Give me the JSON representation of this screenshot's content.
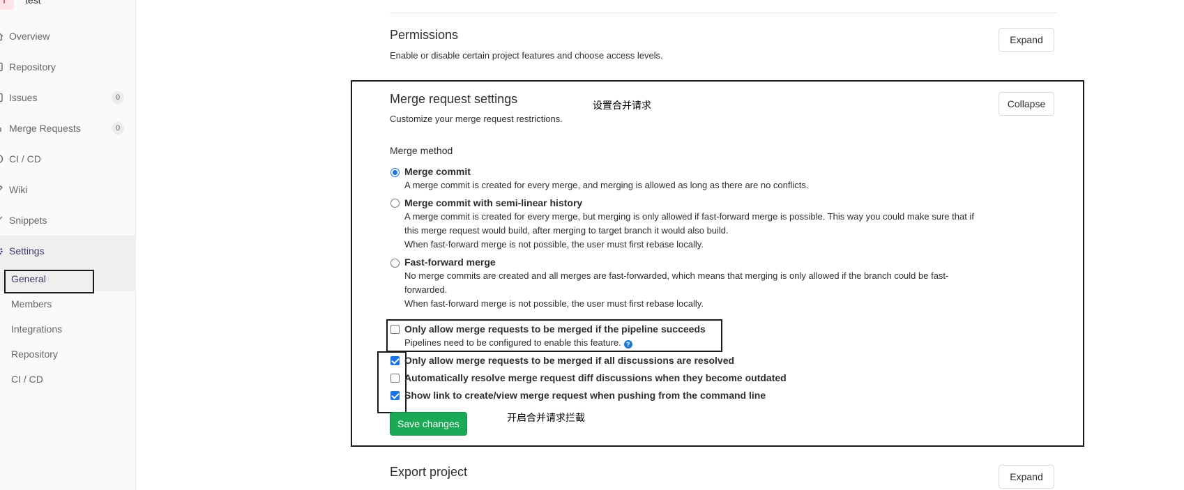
{
  "project": {
    "avatar_letter": "T",
    "name": "test"
  },
  "sidebar": {
    "items": [
      {
        "label": "Overview"
      },
      {
        "label": "Repository"
      },
      {
        "label": "Issues",
        "count": "0"
      },
      {
        "label": "Merge Requests",
        "count": "0"
      },
      {
        "label": "CI / CD"
      },
      {
        "label": "Wiki"
      },
      {
        "label": "Snippets"
      },
      {
        "label": "Settings"
      }
    ],
    "settings_sub": [
      {
        "label": "General"
      },
      {
        "label": "Members"
      },
      {
        "label": "Integrations"
      },
      {
        "label": "Repository"
      },
      {
        "label": "CI / CD"
      }
    ]
  },
  "permissions": {
    "title": "Permissions",
    "description": "Enable or disable certain project features and choose access levels.",
    "button": "Expand"
  },
  "merge_settings": {
    "title": "Merge request settings",
    "description": "Customize your merge request restrictions.",
    "button": "Collapse",
    "method_label": "Merge method",
    "methods": [
      {
        "title": "Merge commit",
        "help": "A merge commit is created for every merge, and merging is allowed as long as there are no conflicts.",
        "checked": true
      },
      {
        "title": "Merge commit with semi-linear history",
        "help": "A merge commit is created for every merge, but merging is only allowed if fast-forward merge is possible. This way you could make sure that if this merge request would build, after merging to target branch it would also build.",
        "help2": "When fast-forward merge is not possible, the user must first rebase locally.",
        "checked": false
      },
      {
        "title": "Fast-forward merge",
        "help": "No merge commits are created and all merges are fast-forwarded, which means that merging is only allowed if the branch could be fast-forwarded.",
        "help2": "When fast-forward merge is not possible, the user must first rebase locally.",
        "checked": false
      }
    ],
    "checks": [
      {
        "title": "Only allow merge requests to be merged if the pipeline succeeds",
        "help": "Pipelines need to be configured to enable this feature.",
        "checked": false
      },
      {
        "title": "Only allow merge requests to be merged if all discussions are resolved",
        "checked": true
      },
      {
        "title": "Automatically resolve merge request diff discussions when they become outdated",
        "checked": false
      },
      {
        "title": "Show link to create/view merge request when pushing from the command line",
        "checked": true
      }
    ],
    "save_label": "Save changes"
  },
  "export": {
    "title": "Export project",
    "button": "Expand"
  },
  "annotations": {
    "merge_settings_note": "设置合并请求",
    "enable_block_note": "开启合并请求拦截"
  },
  "colors": {
    "accent": "#1f78d1",
    "save": "#1aaa55",
    "checkbox": "#1a73e8"
  }
}
